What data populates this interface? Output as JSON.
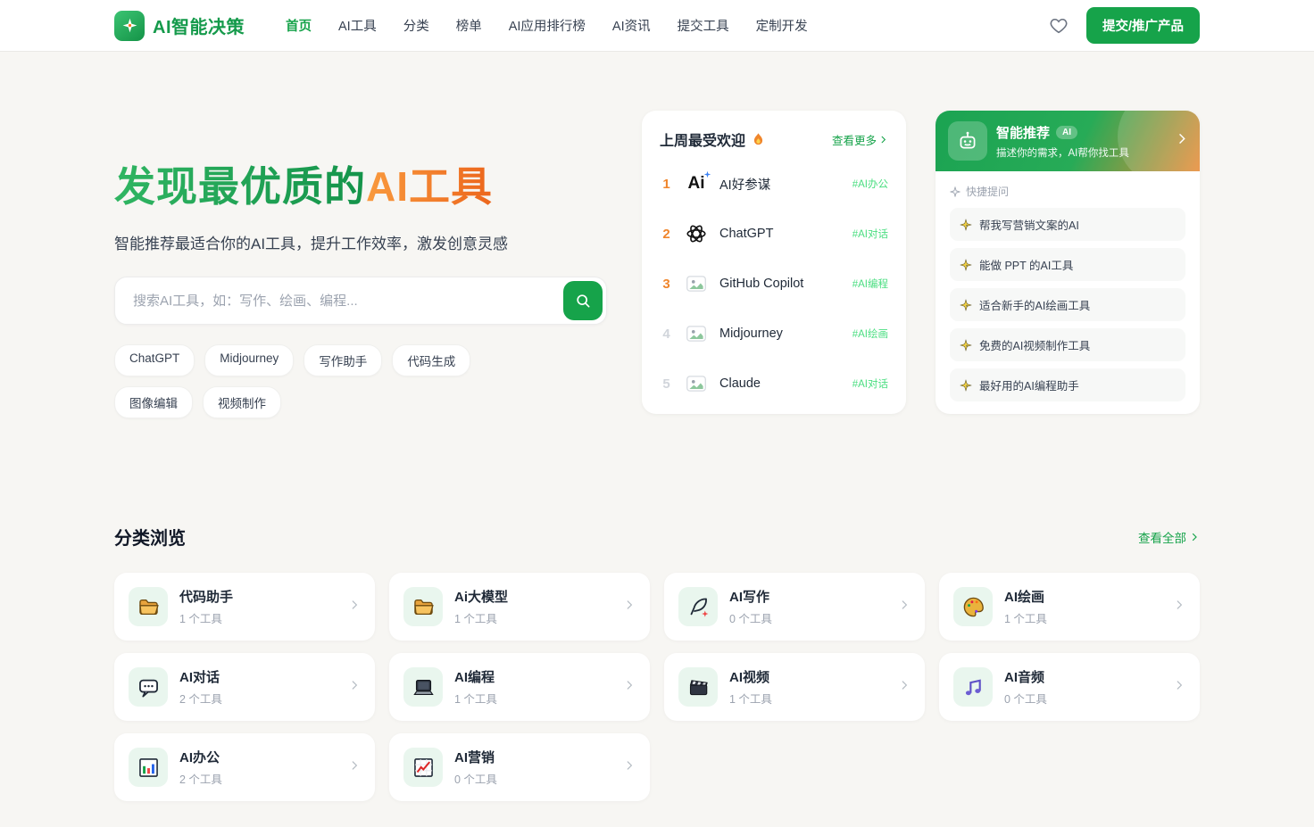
{
  "brand": {
    "name": "AI智能决策",
    "logo_icon": "compass-star-icon"
  },
  "nav": {
    "items": [
      {
        "label": "首页",
        "active": true
      },
      {
        "label": "AI工具",
        "active": false
      },
      {
        "label": "分类",
        "active": false
      },
      {
        "label": "榜单",
        "active": false
      },
      {
        "label": "AI应用排行榜",
        "active": false
      },
      {
        "label": "AI资讯",
        "active": false
      },
      {
        "label": "提交工具",
        "active": false
      },
      {
        "label": "定制开发",
        "active": false
      }
    ],
    "favorite_icon": "heart-icon",
    "submit_button": "提交/推广产品"
  },
  "hero": {
    "title_green": "发现最优质的",
    "title_orange": "AI工具",
    "subtitle": "智能推荐最适合你的AI工具，提升工作效率，激发创意灵感",
    "search": {
      "placeholder": "搜索AI工具，如：写作、绘画、编程...",
      "button_icon": "search-icon"
    },
    "hot_tags": [
      "ChatGPT",
      "Midjourney",
      "写作助手",
      "代码生成",
      "图像编辑",
      "视频制作"
    ]
  },
  "popular": {
    "title": "上周最受欢迎",
    "title_icon": "flame-icon",
    "more_link": "查看更多",
    "items": [
      {
        "rank": "1",
        "name": "AI好参谋",
        "tag": "#AI办公",
        "icon": "ai-text-logo"
      },
      {
        "rank": "2",
        "name": "ChatGPT",
        "tag": "#AI对话",
        "icon": "openai-logo"
      },
      {
        "rank": "3",
        "name": "GitHub Copilot",
        "tag": "#AI编程",
        "icon": "image-placeholder-icon"
      },
      {
        "rank": "4",
        "name": "Midjourney",
        "tag": "#AI绘画",
        "icon": "image-placeholder-icon"
      },
      {
        "rank": "5",
        "name": "Claude",
        "tag": "#AI对话",
        "icon": "image-placeholder-icon"
      }
    ]
  },
  "recommend": {
    "icon": "robot-icon",
    "title": "智能推荐",
    "badge": "AI",
    "subtitle": "描述你的需求，AI帮你找工具",
    "quick_label": "快捷提问",
    "quick_icon": "sparkle-outline-icon",
    "questions": [
      "帮我写营销文案的AI",
      "能做 PPT 的AI工具",
      "适合新手的AI绘画工具",
      "免费的AI视频制作工具",
      "最好用的AI编程助手"
    ]
  },
  "categories": {
    "title": "分类浏览",
    "view_all": "查看全部",
    "items": [
      {
        "name": "代码助手",
        "count": "1 个工具",
        "icon": "folder-icon"
      },
      {
        "name": "Ai大模型",
        "count": "1 个工具",
        "icon": "folder-icon"
      },
      {
        "name": "AI写作",
        "count": "0 个工具",
        "icon": "feather-icon"
      },
      {
        "name": "AI绘画",
        "count": "1 个工具",
        "icon": "palette-icon"
      },
      {
        "name": "AI对话",
        "count": "2 个工具",
        "icon": "chat-bubble-icon"
      },
      {
        "name": "AI编程",
        "count": "1 个工具",
        "icon": "laptop-icon"
      },
      {
        "name": "AI视频",
        "count": "1 个工具",
        "icon": "clapperboard-icon"
      },
      {
        "name": "AI音频",
        "count": "0 个工具",
        "icon": "music-note-icon"
      },
      {
        "name": "AI办公",
        "count": "2 个工具",
        "icon": "bar-chart-icon"
      },
      {
        "name": "AI营销",
        "count": "0 个工具",
        "icon": "line-chart-icon"
      }
    ]
  },
  "colors": {
    "primary_green": "#16a34a",
    "accent_orange": "#f97316",
    "tag_green": "#4ade80"
  }
}
